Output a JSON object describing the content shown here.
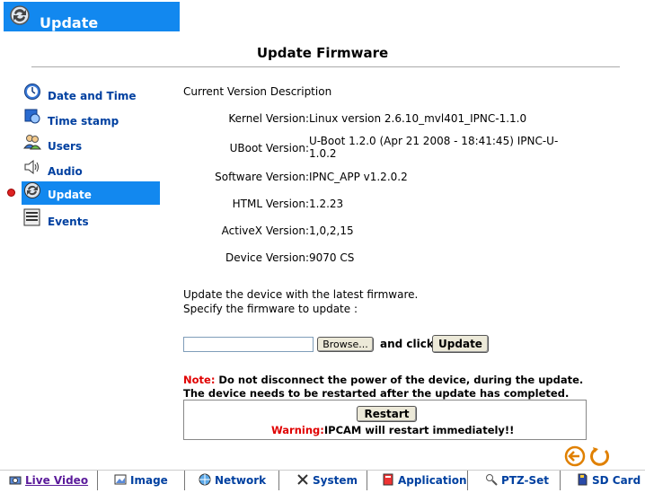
{
  "header": {
    "title": "Update"
  },
  "page_title": "Update Firmware",
  "sidebar": {
    "items": [
      {
        "label": "Date and Time",
        "icon": "clock-icon"
      },
      {
        "label": "Time stamp",
        "icon": "timestamp-icon"
      },
      {
        "label": "Users",
        "icon": "users-icon"
      },
      {
        "label": "Audio",
        "icon": "speaker-icon"
      },
      {
        "label": "Update",
        "icon": "update-icon",
        "selected": true
      },
      {
        "label": "Events",
        "icon": "events-icon"
      }
    ]
  },
  "version": {
    "heading": "Current Version Description",
    "rows": [
      {
        "key": "Kernel Version:",
        "value": "Linux version 2.6.10_mvl401_IPNC-1.1.0"
      },
      {
        "key": "UBoot Version:",
        "value": "U-Boot 1.2.0 (Apr 21 2008 - 18:41:45) IPNC-U-1.0.2"
      },
      {
        "key": "Software Version:",
        "value": "IPNC_APP v1.2.0.2"
      },
      {
        "key": "HTML Version:",
        "value": "1.2.23"
      },
      {
        "key": "ActiveX Version:",
        "value": "1,0,2,15"
      },
      {
        "key": "Device Version:",
        "value": "9070 CS"
      }
    ]
  },
  "update": {
    "line1": "Update the device with the latest firmware.",
    "line2": "Specify the firmware to update :",
    "file_value": "",
    "browse_label": "Browse...",
    "and_click": "and click",
    "update_label": "Update"
  },
  "note": {
    "prefix": "Note:",
    "line1": " Do not disconnect the power of the device, during the update.",
    "line2": "The device needs to be restarted after the update has completed."
  },
  "restart": {
    "button_label": "Restart",
    "warning_prefix": "Warning:",
    "warning_text": "IPCAM will restart immediately!!"
  },
  "bottom_tabs": [
    {
      "label": "Live Video",
      "icon": "camera-icon"
    },
    {
      "label": "Image",
      "icon": "image-icon"
    },
    {
      "label": "Network",
      "icon": "network-icon"
    },
    {
      "label": "System",
      "icon": "tools-icon"
    },
    {
      "label": "Application",
      "icon": "application-icon"
    },
    {
      "label": "PTZ-Set",
      "icon": "magnifier-icon"
    },
    {
      "label": "SD Card",
      "icon": "sdcard-icon"
    }
  ],
  "colors": {
    "accent": "#1288ef",
    "link": "#0040a0",
    "warning": "#e00000",
    "nav_arrows": "#e08000"
  }
}
